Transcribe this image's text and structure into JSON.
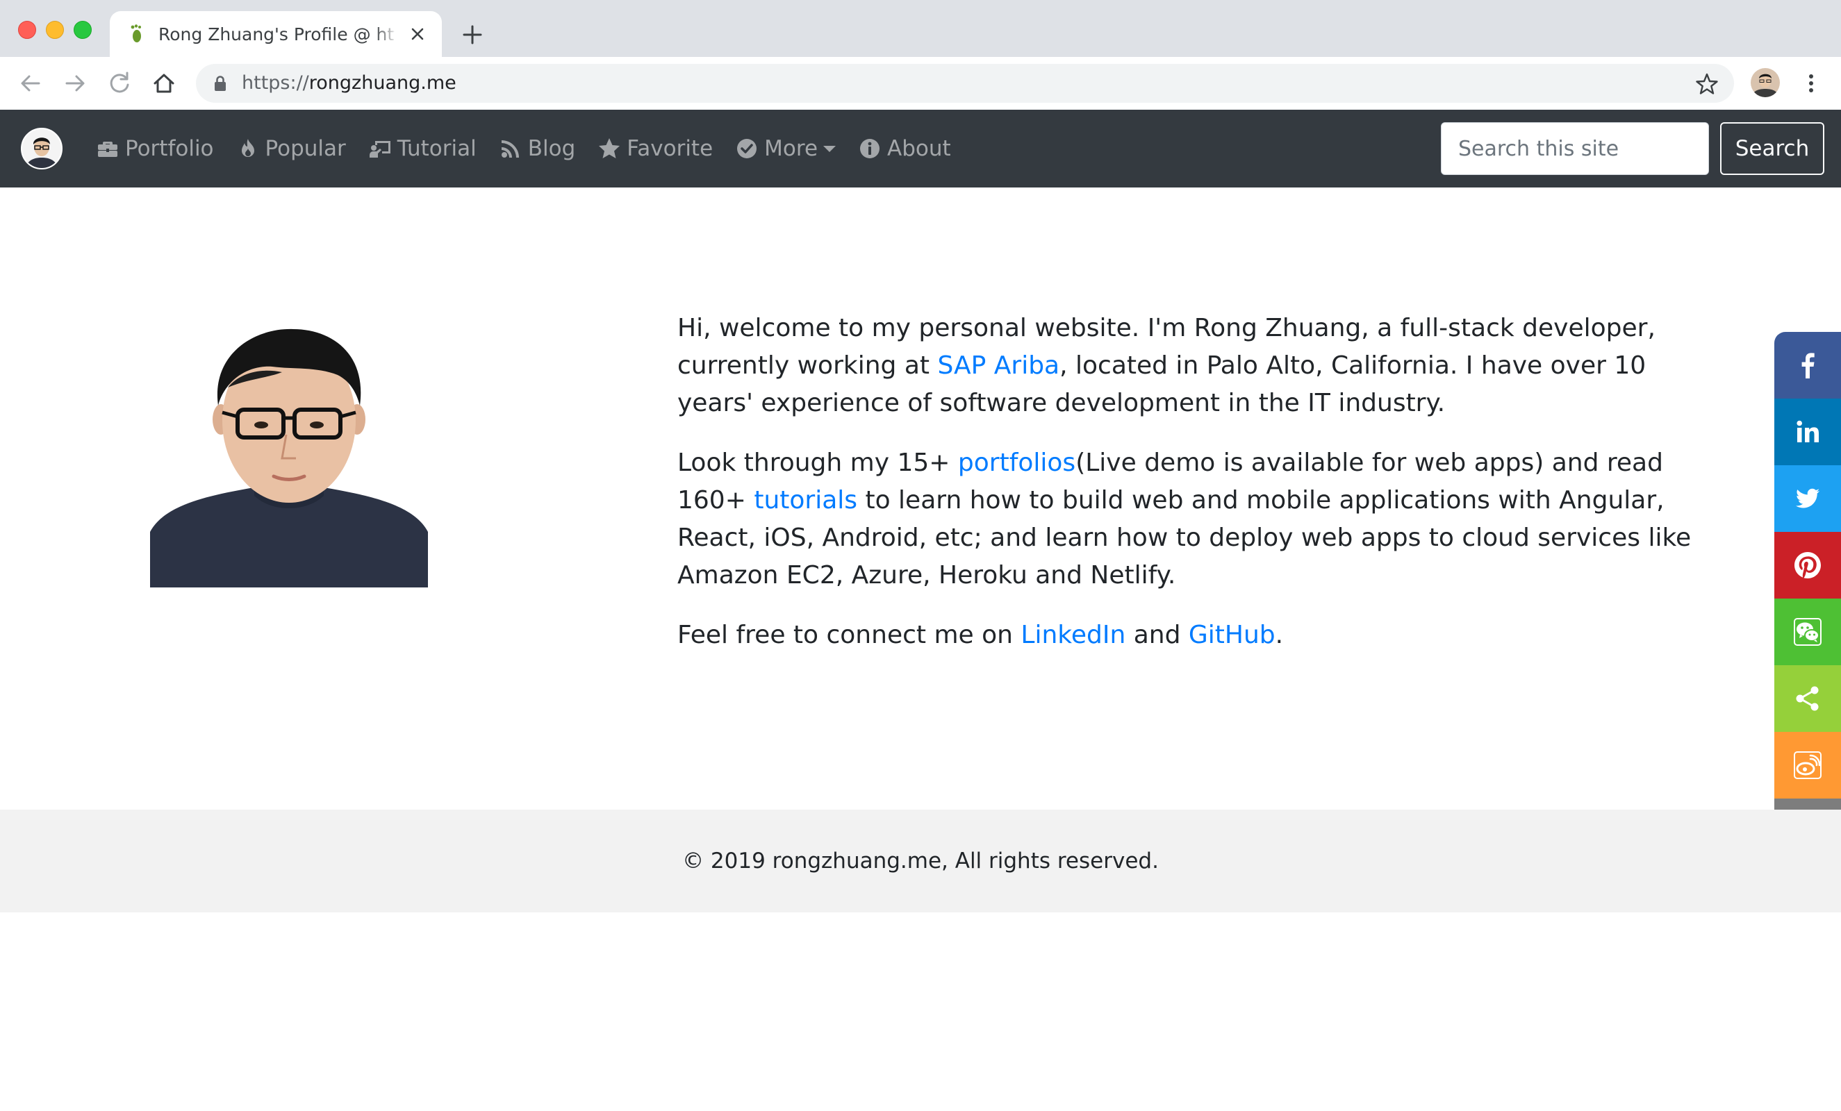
{
  "browser": {
    "tab_title": "Rong Zhuang's Profile @ http://rongzhuang.me",
    "url_scheme": "https://",
    "url_host": "rongzhuang.me"
  },
  "navbar": {
    "links": [
      {
        "label": "Portfolio",
        "icon": "briefcase-icon"
      },
      {
        "label": "Popular",
        "icon": "fire-icon"
      },
      {
        "label": "Tutorial",
        "icon": "chalkboard-teacher-icon"
      },
      {
        "label": "Blog",
        "icon": "rss-icon"
      },
      {
        "label": "Favorite",
        "icon": "star-icon"
      },
      {
        "label": "More",
        "icon": "check-circle-icon"
      },
      {
        "label": "About",
        "icon": "info-circle-icon"
      }
    ],
    "search_placeholder": "Search this site",
    "search_button": "Search"
  },
  "intro": {
    "p1_a": "Hi, welcome to my personal website. I'm Rong Zhuang, a full-stack developer, currently working at ",
    "p1_link": "SAP Ariba",
    "p1_b": ", located in Palo Alto, California. I have over 10 years' experience of software development in the IT industry.",
    "p2_a": "Look through my 15+ ",
    "p2_link1": "portfolios",
    "p2_b": "(Live demo is available for web apps) and read 160+ ",
    "p2_link2": "tutorials",
    "p2_c": " to learn how to build web and mobile applications with Angular, React, iOS, Android, etc; and learn how to deploy web apps to cloud services like Amazon EC2, Azure, Heroku and Netlify.",
    "p3_a": "Feel free to connect me on ",
    "p3_link1": "LinkedIn",
    "p3_b": " and ",
    "p3_link2": "GitHub",
    "p3_c": "."
  },
  "share": [
    {
      "name": "facebook",
      "color": "#3b5998"
    },
    {
      "name": "linkedin",
      "color": "#0077b5"
    },
    {
      "name": "twitter",
      "color": "#1da1f2"
    },
    {
      "name": "pinterest",
      "color": "#cb2027"
    },
    {
      "name": "wechat",
      "color": "#4ec034"
    },
    {
      "name": "sharethis",
      "color": "#95d03a"
    },
    {
      "name": "weibo",
      "color": "#ff9933"
    },
    {
      "name": "email",
      "color": "#7d7d7d"
    }
  ],
  "footer": {
    "text": "© 2019 rongzhuang.me, All rights reserved."
  }
}
